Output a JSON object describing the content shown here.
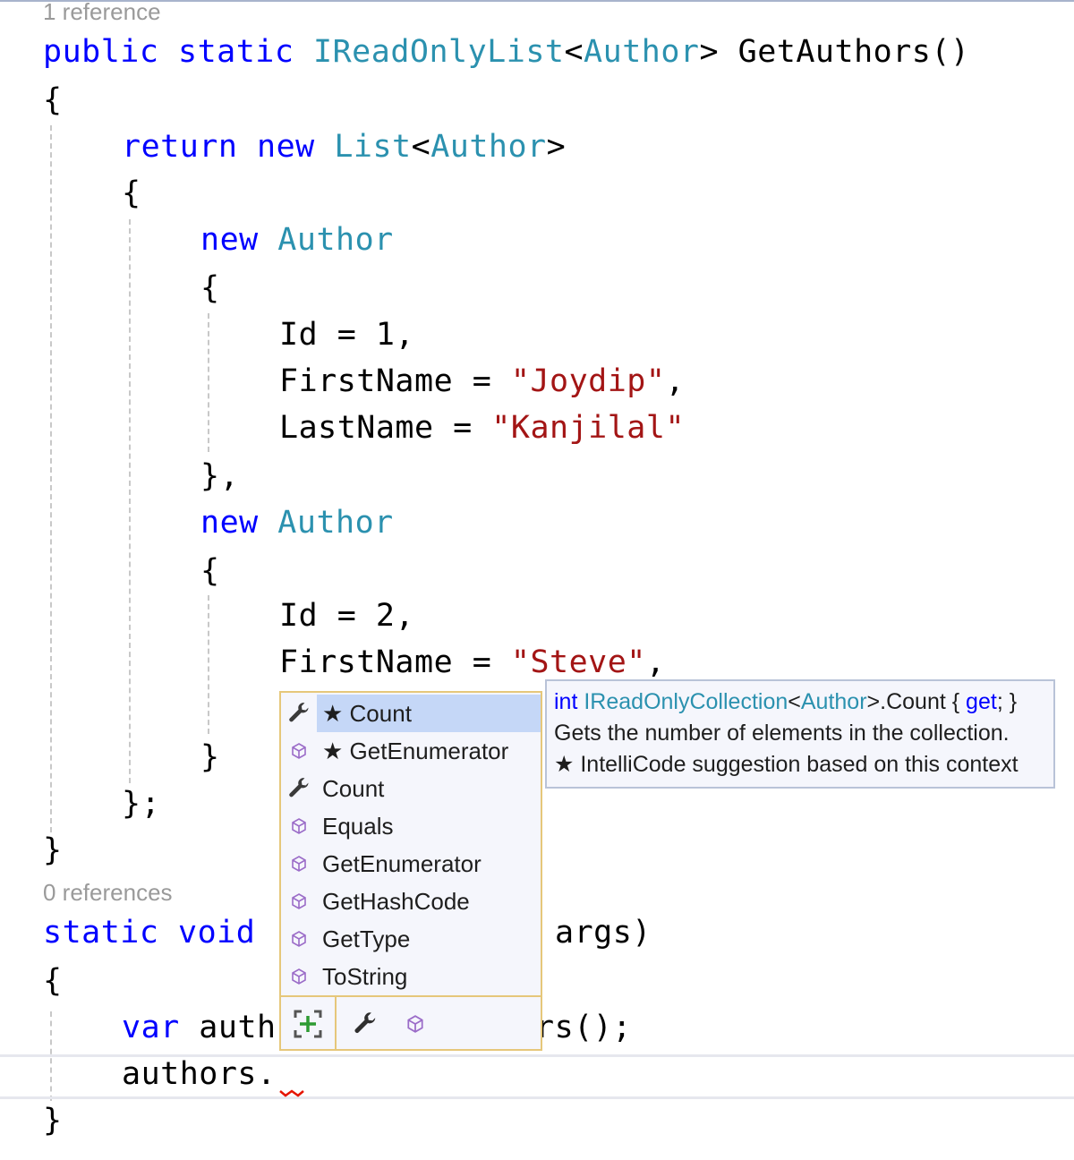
{
  "codelens": {
    "get_authors_refs": "1 reference",
    "main_refs": "0 references"
  },
  "code": {
    "l1": {
      "mod1": "public",
      "mod2": "static",
      "type": "IReadOnlyList",
      "lt": "<",
      "generic": "Author",
      "gt": ">",
      "name": " GetAuthors()"
    },
    "l2": "{",
    "l3": {
      "kw1": "return",
      "kw2": "new",
      "type": "List",
      "lt": "<",
      "generic": "Author",
      "gt": ">"
    },
    "l4": "{",
    "l5": {
      "kw": "new",
      "type": "Author"
    },
    "l6": "{",
    "l7": {
      "prop": "Id",
      "op": " = ",
      "val": "1,"
    },
    "l8": {
      "prop": "FirstName",
      "op": " = ",
      "str": "\"Joydip\"",
      "tail": ","
    },
    "l9": {
      "prop": "LastName",
      "op": " = ",
      "str": "\"Kanjilal\""
    },
    "l10": "},",
    "l11": {
      "kw": "new",
      "type": "Author"
    },
    "l12": "{",
    "l13": {
      "prop": "Id",
      "op": " = ",
      "val": "2,"
    },
    "l14": {
      "prop": "FirstName",
      "op": " = ",
      "str": "\"Steve\"",
      "tail": ","
    },
    "l16": "}",
    "l17": "};",
    "l18": "}",
    "l19": {
      "kw1": "static",
      "kw2": "void",
      "tail": "args)"
    },
    "l20": "{",
    "l21": {
      "kw": "var",
      "head": "auth",
      "tail": "rs();"
    },
    "l22": "authors.",
    "l23": "}"
  },
  "completion": {
    "items": [
      {
        "label": "★ Count",
        "icon": "wrench-icon",
        "selected": true
      },
      {
        "label": "★ GetEnumerator",
        "icon": "method-cube-icon",
        "selected": false
      },
      {
        "label": "Count",
        "icon": "wrench-icon",
        "selected": false
      },
      {
        "label": "Equals",
        "icon": "method-cube-icon",
        "selected": false
      },
      {
        "label": "GetEnumerator",
        "icon": "method-cube-icon",
        "selected": false
      },
      {
        "label": "GetHashCode",
        "icon": "method-cube-icon",
        "selected": false
      },
      {
        "label": "GetType",
        "icon": "method-cube-icon",
        "selected": false
      },
      {
        "label": "ToString",
        "icon": "method-cube-icon",
        "selected": false
      }
    ],
    "footer": {
      "expand_icon": "add-bracket-icon",
      "filter_icons": [
        "wrench-icon",
        "method-cube-icon"
      ]
    }
  },
  "tooltip": {
    "sig": {
      "kw": "int",
      "type": "IReadOnlyCollection",
      "lt": "<",
      "generic": "Author",
      "mid": ">.Count { ",
      "get": "get",
      "end": "; }"
    },
    "description": "Gets the number of elements in the collection.",
    "intellicode": "★  IntelliCode suggestion based on this context"
  },
  "colors": {
    "keyword": "#0000ff",
    "type": "#2b91af",
    "string": "#a31515",
    "selection": "#c5d7f7",
    "popup_border": "#e6c77a",
    "method_icon": "#9b6cc8",
    "error": "#e51400"
  }
}
